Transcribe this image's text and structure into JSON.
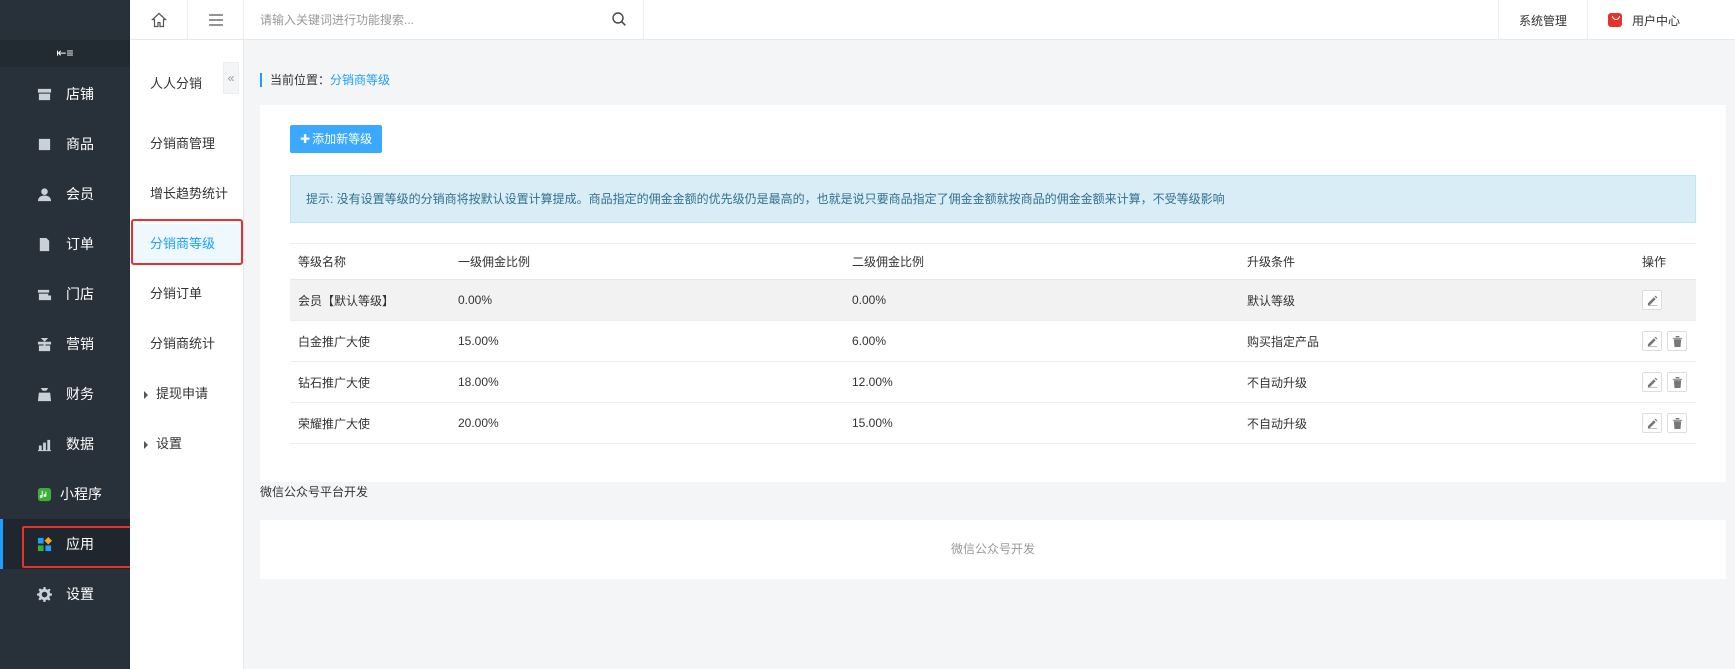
{
  "sidebar": {
    "collapse_icon": "collapse-menu-icon",
    "items": [
      {
        "label": "店铺",
        "icon": "store-icon"
      },
      {
        "label": "商品",
        "icon": "product-icon"
      },
      {
        "label": "会员",
        "icon": "member-icon"
      },
      {
        "label": "订单",
        "icon": "order-icon"
      },
      {
        "label": "门店",
        "icon": "shop-icon"
      },
      {
        "label": "营销",
        "icon": "gift-icon"
      },
      {
        "label": "财务",
        "icon": "finance-icon"
      },
      {
        "label": "数据",
        "icon": "chart-icon"
      },
      {
        "label": "小程序",
        "icon": "miniprogram-icon"
      },
      {
        "label": "应用",
        "icon": "apps-icon",
        "active": true
      },
      {
        "label": "设置",
        "icon": "gear-icon"
      }
    ]
  },
  "submenu": {
    "title": "人人分销",
    "items": [
      {
        "label": "分销商管理"
      },
      {
        "label": "增长趋势统计"
      },
      {
        "label": "分销商等级",
        "active": true
      },
      {
        "label": "分销订单"
      },
      {
        "label": "分销商统计"
      },
      {
        "label": "提现申请",
        "expandable": true
      },
      {
        "label": "设置",
        "expandable": true
      }
    ]
  },
  "topbar": {
    "search_placeholder": "请输入关键词进行功能搜索...",
    "system_label": "系统管理",
    "user_label": "用户中心"
  },
  "breadcrumb": {
    "prefix": "当前位置：",
    "current": "分销商等级"
  },
  "main": {
    "add_button": "添加新等级",
    "tip": "提示: 没有设置等级的分销商将按默认设置计算提成。商品指定的佣金金额的优先级仍是最高的，也就是说只要商品指定了佣金金额就按商品的佣金金额来计算，不受等级影响",
    "table": {
      "headers": [
        "等级名称",
        "一级佣金比例",
        "二级佣金比例",
        "升级条件",
        "操作"
      ],
      "rows": [
        {
          "name": "会员【默认等级】",
          "level1": "0.00%",
          "level2": "0.00%",
          "condition": "默认等级",
          "deletable": false
        },
        {
          "name": "白金推广大使",
          "level1": "15.00%",
          "level2": "6.00%",
          "condition": "购买指定产品",
          "deletable": true
        },
        {
          "name": "钻石推广大使",
          "level1": "18.00%",
          "level2": "12.00%",
          "condition": "不自动升级",
          "deletable": true
        },
        {
          "name": "荣耀推广大使",
          "level1": "20.00%",
          "level2": "15.00%",
          "condition": "不自动升级",
          "deletable": true
        }
      ]
    }
  },
  "wechat": {
    "section_label": "微信公众号平台开发",
    "panel_text": "微信公众号开发"
  },
  "colors": {
    "sidebar_bg": "#283039",
    "accent": "#1e9fff",
    "button": "#3ba9ff",
    "highlight_box": "#e5322d",
    "tip_bg": "#d9edf7"
  }
}
